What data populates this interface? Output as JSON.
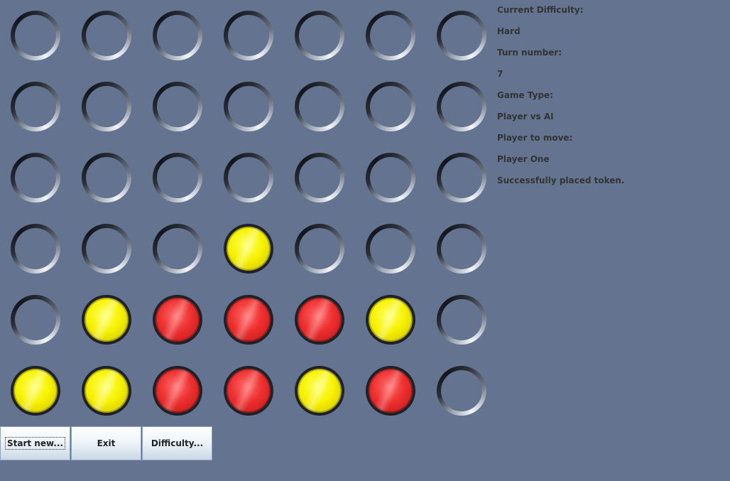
{
  "board": {
    "rows": 6,
    "cols": 7,
    "grid": [
      [
        "empty",
        "empty",
        "empty",
        "empty",
        "empty",
        "empty",
        "empty"
      ],
      [
        "empty",
        "empty",
        "empty",
        "empty",
        "empty",
        "empty",
        "empty"
      ],
      [
        "empty",
        "empty",
        "empty",
        "empty",
        "empty",
        "empty",
        "empty"
      ],
      [
        "empty",
        "empty",
        "empty",
        "yellow",
        "empty",
        "empty",
        "empty"
      ],
      [
        "empty",
        "yellow",
        "red",
        "red",
        "red",
        "yellow",
        "empty"
      ],
      [
        "yellow",
        "yellow",
        "red",
        "red",
        "yellow",
        "red",
        "empty"
      ]
    ],
    "colors": {
      "background": "#647490",
      "yellow": "#f7f200",
      "red": "#ee2f2f"
    }
  },
  "info": {
    "difficulty_label": "Current Difficulty:",
    "difficulty_value": "Hard",
    "turn_label": "Turn number:",
    "turn_value": "7",
    "game_type_label": "Game Type:",
    "game_type_value": "Player vs AI",
    "player_label": "Player to move:",
    "player_value": "Player One",
    "status": "Successfully placed token."
  },
  "buttons": {
    "start_new": "Start new...",
    "exit": "Exit",
    "difficulty": "Difficulty..."
  }
}
